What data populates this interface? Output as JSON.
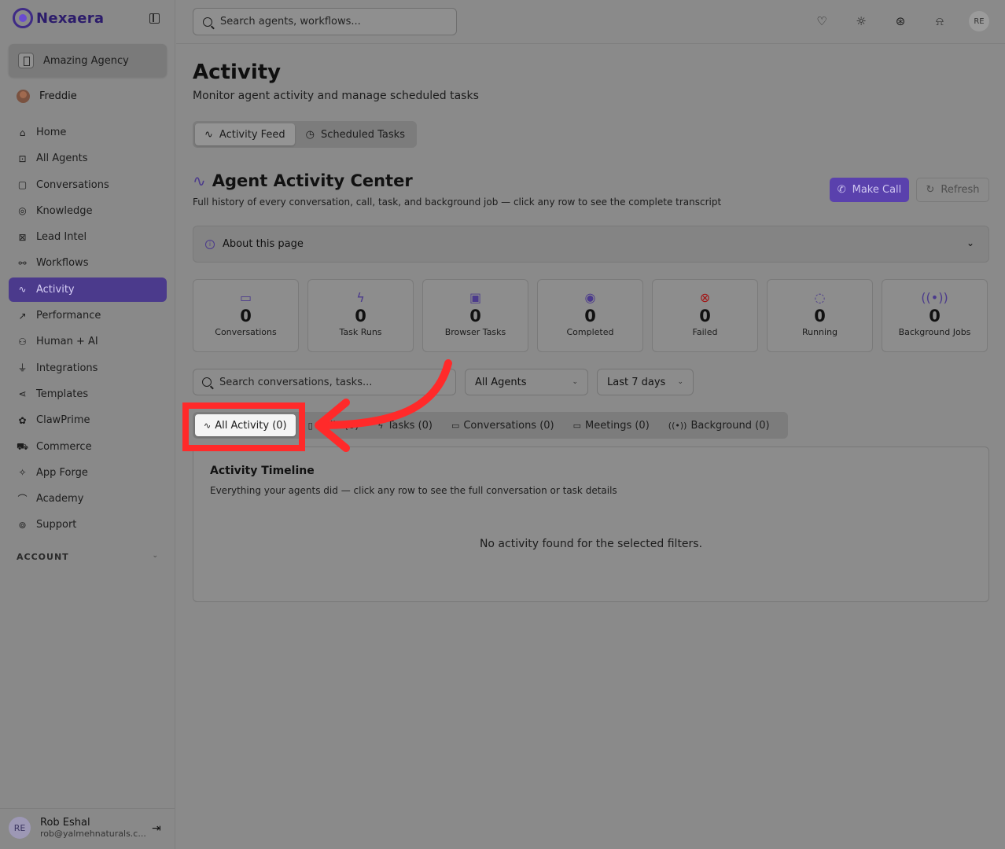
{
  "app": {
    "logo_text": "Nexaera",
    "org_name": "Amazing Agency",
    "current_user": "Freddie"
  },
  "sidebar": {
    "items": [
      {
        "label": "Home",
        "icon": "home-icon",
        "glyph": "⌂"
      },
      {
        "label": "All Agents",
        "icon": "bot-icon",
        "glyph": "⊡"
      },
      {
        "label": "Conversations",
        "icon": "chat-icon",
        "glyph": "▢"
      },
      {
        "label": "Knowledge",
        "icon": "brain-icon",
        "glyph": "◎"
      },
      {
        "label": "Lead Intel",
        "icon": "contact-icon",
        "glyph": "⊠"
      },
      {
        "label": "Workflows",
        "icon": "workflow-icon",
        "glyph": "⚯"
      },
      {
        "label": "Activity",
        "icon": "activity-icon",
        "glyph": "∿"
      },
      {
        "label": "Performance",
        "icon": "trend-icon",
        "glyph": "↗"
      },
      {
        "label": "Human + AI",
        "icon": "network-icon",
        "glyph": "⚇"
      },
      {
        "label": "Integrations",
        "icon": "plug-icon",
        "glyph": "⏚"
      },
      {
        "label": "Templates",
        "icon": "share-icon",
        "glyph": "⋖"
      },
      {
        "label": "ClawPrime",
        "icon": "clawprime-icon",
        "glyph": "✿"
      },
      {
        "label": "Commerce",
        "icon": "cart-icon",
        "glyph": "⛟"
      },
      {
        "label": "App Forge",
        "icon": "sparkles-icon",
        "glyph": "✧"
      },
      {
        "label": "Academy",
        "icon": "graduation-icon",
        "glyph": "⌒"
      },
      {
        "label": "Support",
        "icon": "lifebuoy-icon",
        "glyph": "⊚"
      }
    ],
    "active_index": 6,
    "account_label": "ACCOUNT",
    "footer": {
      "avatar": "RE",
      "name": "Rob Eshal",
      "email": "rob@yalmehnaturals.c..."
    }
  },
  "topbar": {
    "search_placeholder": "Search agents, workflows...",
    "avatar": "RE"
  },
  "page": {
    "title": "Activity",
    "subtitle": "Monitor agent activity and manage scheduled tasks",
    "segments": [
      {
        "label": "Activity Feed",
        "glyph": "∿"
      },
      {
        "label": "Scheduled Tasks",
        "glyph": "◷"
      }
    ]
  },
  "center": {
    "title": "Agent Activity Center",
    "subtitle": "Full history of every conversation, call, task, and background job — click any row to see the complete transcript",
    "make_call": "Make Call",
    "refresh": "Refresh",
    "about": "About this page"
  },
  "stats": [
    {
      "value": "0",
      "label": "Conversations",
      "icon": "message-icon",
      "glyph": "▭",
      "color": "#4b3a8c"
    },
    {
      "value": "0",
      "label": "Task Runs",
      "icon": "zap-icon",
      "glyph": "ϟ",
      "color": "#4b3a8c"
    },
    {
      "value": "0",
      "label": "Browser Tasks",
      "icon": "monitor-icon",
      "glyph": "▣",
      "color": "#4b3a8c"
    },
    {
      "value": "0",
      "label": "Completed",
      "icon": "check-circle-icon",
      "glyph": "◉",
      "color": "#4b3a8c"
    },
    {
      "value": "0",
      "label": "Failed",
      "icon": "x-circle-icon",
      "glyph": "⊗",
      "color": "#a31616"
    },
    {
      "value": "0",
      "label": "Running",
      "icon": "loader-icon",
      "glyph": "◌",
      "color": "#4b3a8c"
    },
    {
      "value": "0",
      "label": "Background Jobs",
      "icon": "radio-icon",
      "glyph": "((•))",
      "color": "#4b3a8c"
    }
  ],
  "filters": {
    "search_placeholder": "Search conversations, tasks...",
    "agent": "All Agents",
    "range": "Last 7 days"
  },
  "tabs": [
    {
      "label": "All Activity (0)",
      "glyph": "∿"
    },
    {
      "label": "Calls (0)",
      "glyph": "▯"
    },
    {
      "label": "Tasks (0)",
      "glyph": "ϟ"
    },
    {
      "label": "Conversations (0)",
      "glyph": "▭"
    },
    {
      "label": "Meetings (0)",
      "glyph": "▭"
    },
    {
      "label": "Background (0)",
      "glyph": "((•))"
    }
  ],
  "timeline": {
    "title": "Activity Timeline",
    "subtitle": "Everything your agents did — click any row to see the full conversation or task details",
    "empty": "No activity found for the selected filters."
  },
  "colors": {
    "accent": "#4b3a8c",
    "highlight": "#ff2a2a"
  }
}
